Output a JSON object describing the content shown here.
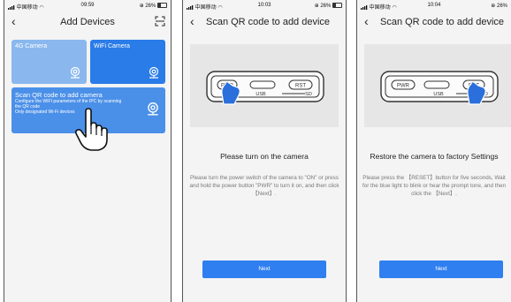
{
  "screens": [
    {
      "status": {
        "carrier": "中国移动",
        "time": "09:59",
        "battery": "26%"
      },
      "nav": {
        "back_icon": "‹",
        "title": "Add Devices",
        "right_icon": "scan-icon"
      },
      "cards": {
        "camera_4g": {
          "label": "4G Camera",
          "icon": "camera-icon"
        },
        "wifi_camera": {
          "label": "WiFi Camera",
          "icon": "camera-icon"
        },
        "scan_qr": {
          "title": "Scan QR code to add camera",
          "line1": "Configure the WIFI parameters of the IPC by scanning",
          "line2": "the QR code",
          "line3": "Only designated Wi-Fi devices"
        }
      },
      "colors": {
        "card_light": "#8ab8ee",
        "card_dark": "#2a7ce8",
        "card_qr": "#4b90e8"
      }
    },
    {
      "status": {
        "carrier": "中国移动",
        "time": "10:03",
        "battery": "26%"
      },
      "nav": {
        "back_icon": "‹",
        "title": "Scan QR code to add device"
      },
      "device": {
        "pwr": "PWR",
        "usb": "USB",
        "rst": "RST",
        "sd": "SD"
      },
      "heading": "Please turn on the camera",
      "description": "Please turn the power switch of the camera to \"ON\" or press and hold the power button \"PWR\" to turn it on, and then click【Next】.",
      "next_button": "Next"
    },
    {
      "status": {
        "carrier": "中国移动",
        "time": "10:04",
        "battery": "26%"
      },
      "nav": {
        "back_icon": "‹",
        "title": "Scan QR code to add device"
      },
      "device": {
        "pwr": "PWR",
        "usb": "USB",
        "rst": "RST",
        "sd": "SD"
      },
      "heading": "Restore the camera to factory Settings",
      "description": "Please press the 【RESET】button for five seconds, Wait for the blue light to blink or hear the prompt tone, and then click the 【Next】.",
      "next_button": "Next"
    }
  ]
}
